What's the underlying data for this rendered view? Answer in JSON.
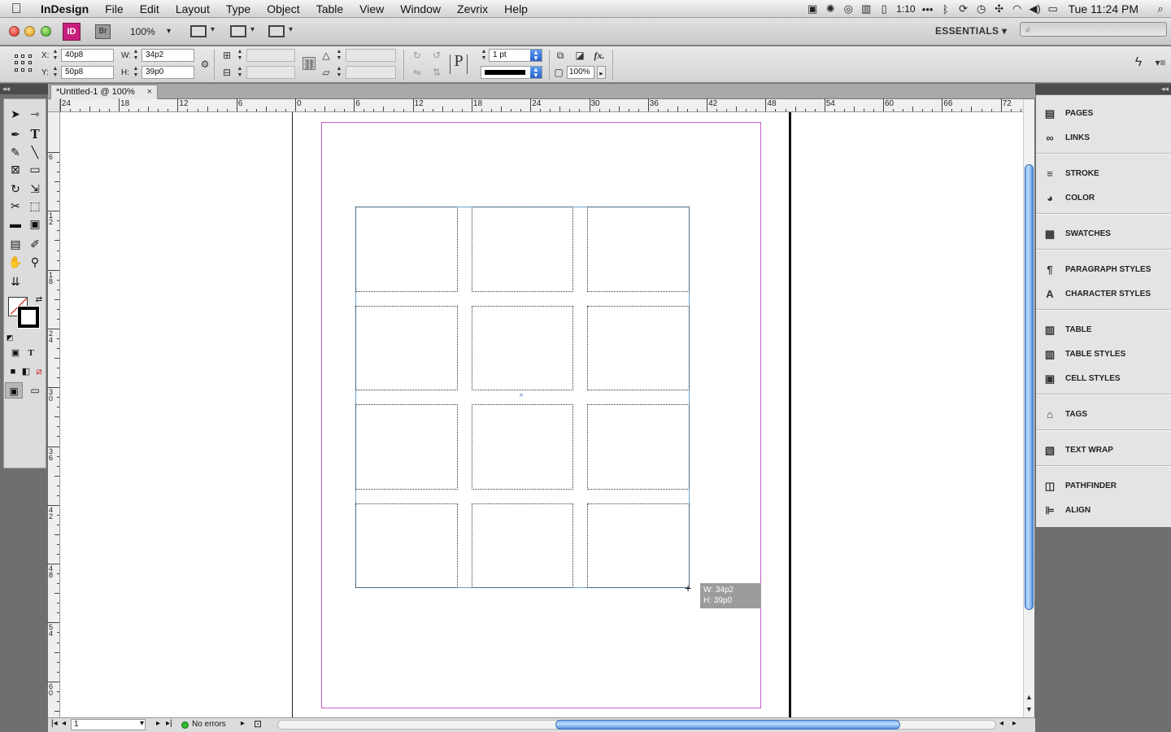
{
  "menubar": {
    "apple_icon": "",
    "menus": [
      "InDesign",
      "File",
      "Edit",
      "Layout",
      "Type",
      "Object",
      "Table",
      "View",
      "Window",
      "Zevrix",
      "Help"
    ],
    "battery_time": "1:10",
    "clock": "Tue 11:24 PM"
  },
  "appbar": {
    "app_logo": "ID",
    "bridge_logo": "Br",
    "zoom": "100%",
    "workspace": "ESSENTIALS ▾"
  },
  "control_panel": {
    "x_label": "X:",
    "x_value": "40p8",
    "y_label": "Y:",
    "y_value": "50p8",
    "w_label": "W:",
    "w_value": "34p2",
    "h_label": "H:",
    "h_value": "39p0",
    "stroke_weight": "1 pt",
    "opacity": "100%",
    "text_icon": "P",
    "fx_label": "fx."
  },
  "document": {
    "tab_title": "*Untitled-1 @ 100%",
    "tab_close": "×",
    "ruler_h_labels": [
      "24",
      "18",
      "12",
      "6",
      "0",
      "6",
      "12",
      "18",
      "24",
      "30",
      "36",
      "42",
      "48",
      "54",
      "60",
      "66",
      "72"
    ],
    "ruler_v_labels": [
      "6",
      "12",
      "18",
      "24",
      "30",
      "36",
      "42",
      "48",
      "54",
      "60"
    ],
    "center_mark": "×",
    "size_tooltip": {
      "w": "W: 34p2",
      "h": "H: 39p0"
    },
    "grid": {
      "rows": 4,
      "cols": 3
    }
  },
  "statusbar": {
    "page_number": "1",
    "preflight": "No errors"
  },
  "panels": [
    {
      "icon": "pages-icon",
      "glyph": "▤",
      "label": "PAGES"
    },
    {
      "icon": "links-icon",
      "glyph": "∞",
      "label": "LINKS"
    },
    {
      "icon": "stroke-icon",
      "glyph": "≡",
      "label": "STROKE"
    },
    {
      "icon": "color-icon",
      "glyph": "◕",
      "label": "COLOR"
    },
    {
      "icon": "swatches-icon",
      "glyph": "▦",
      "label": "SWATCHES"
    },
    {
      "icon": "paragraph-styles-icon",
      "glyph": "¶",
      "label": "PARAGRAPH STYLES"
    },
    {
      "icon": "character-styles-icon",
      "glyph": "A",
      "label": "CHARACTER STYLES"
    },
    {
      "icon": "table-icon",
      "glyph": "▥",
      "label": "TABLE"
    },
    {
      "icon": "table-styles-icon",
      "glyph": "▥",
      "label": "TABLE STYLES"
    },
    {
      "icon": "cell-styles-icon",
      "glyph": "▣",
      "label": "CELL STYLES"
    },
    {
      "icon": "tags-icon",
      "glyph": "⌂",
      "label": "TAGS"
    },
    {
      "icon": "text-wrap-icon",
      "glyph": "▧",
      "label": "TEXT WRAP"
    },
    {
      "icon": "pathfinder-icon",
      "glyph": "◫",
      "label": "PATHFINDER"
    },
    {
      "icon": "align-icon",
      "glyph": "⊫",
      "label": "ALIGN"
    }
  ],
  "colors": {
    "margin_guide": "#c45ec9",
    "frame_edge": "#6aa6d3",
    "scroll_thumb": "#5e9cf2",
    "indesign_brand": "#c8207f"
  }
}
